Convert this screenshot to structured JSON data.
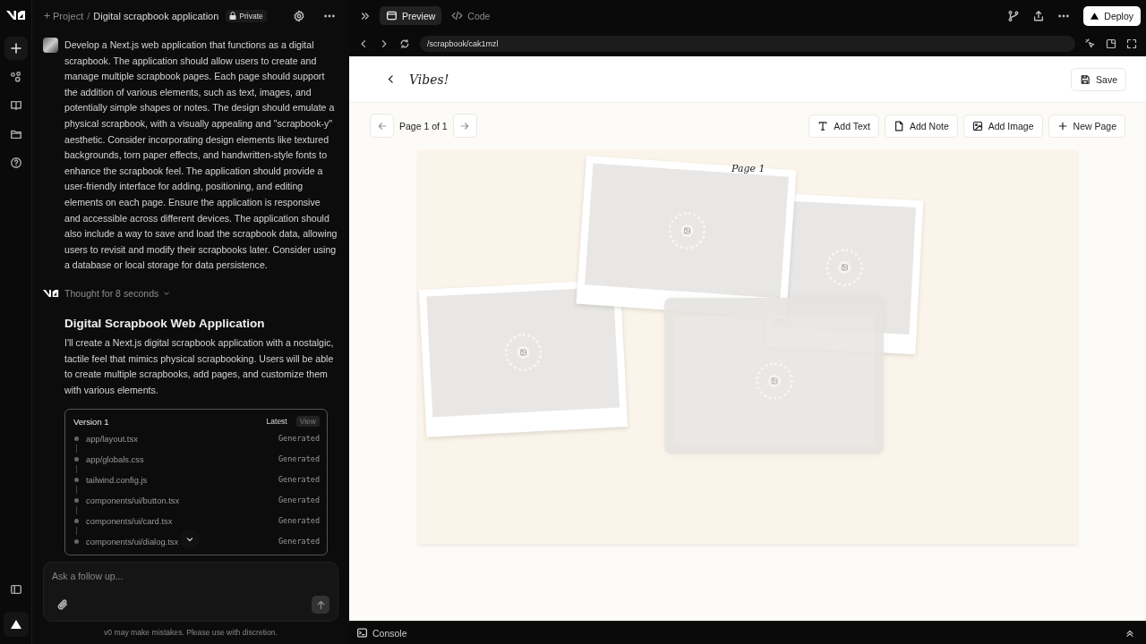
{
  "header": {
    "prefix": "Project",
    "separator": "/",
    "title": "Digital scrapbook application",
    "badge": "Private"
  },
  "chat": {
    "prompt": "Develop a Next.js web application that functions as a digital scrapbook. The application should allow users to create and manage multiple scrapbook pages. Each page should support the addition of various elements, such as text, images, and potentially simple shapes or notes. The design should emulate a physical scrapbook, with a visually appealing and \"scrapbook-y\" aesthetic. Consider incorporating design elements like textured backgrounds, torn paper effects, and handwritten-style fonts to enhance the scrapbook feel. The application should provide a user-friendly interface for adding, positioning, and editing elements on each page. Ensure the application is responsive and accessible across different devices. The application should also include a way to save and load the scrapbook data, allowing users to revisit and modify their scrapbooks later. Consider using a database or local storage for data persistence.",
    "thought": "Thought for 8 seconds",
    "heading": "Digital Scrapbook Web Application",
    "answer": "I'll create a Next.js digital scrapbook application with a nostalgic, tactile feel that mimics physical scrapbooking. Users will be able to create multiple scrapbooks, add pages, and customize them with various elements.",
    "version": {
      "title": "Version 1",
      "status": "Latest",
      "action": "View",
      "files": [
        {
          "name": "app/layout.tsx",
          "status": "Generated"
        },
        {
          "name": "app/globals.css",
          "status": "Generated"
        },
        {
          "name": "tailwind.config.js",
          "status": "Generated"
        },
        {
          "name": "components/ui/button.tsx",
          "status": "Generated"
        },
        {
          "name": "components/ui/card.tsx",
          "status": "Generated"
        },
        {
          "name": "components/ui/dialog.tsx",
          "status": "Generated"
        }
      ]
    },
    "composer": {
      "placeholder": "Ask a follow up..."
    },
    "disclaimer": "v0 may make mistakes. Please use with discretion."
  },
  "preview": {
    "tabs": [
      {
        "label": "Preview",
        "kind": "preview",
        "selected": true
      },
      {
        "label": "Code",
        "kind": "code",
        "selected": false
      }
    ],
    "deploy": "Deploy",
    "url": "/scrapbook/cak1mzl"
  },
  "app": {
    "title": "Vibes!",
    "save": "Save",
    "pager": "Page 1 of 1",
    "tools": [
      {
        "label": "Add Text",
        "kind": "text"
      },
      {
        "label": "Add Note",
        "kind": "note"
      },
      {
        "label": "Add Image",
        "kind": "image"
      },
      {
        "label": "New Page",
        "kind": "plus"
      }
    ],
    "page_label": "Page 1",
    "elements": [
      {
        "kind": "photo"
      },
      {
        "kind": "photo"
      },
      {
        "kind": "photo"
      },
      {
        "kind": "faded"
      }
    ]
  },
  "console": "Console"
}
